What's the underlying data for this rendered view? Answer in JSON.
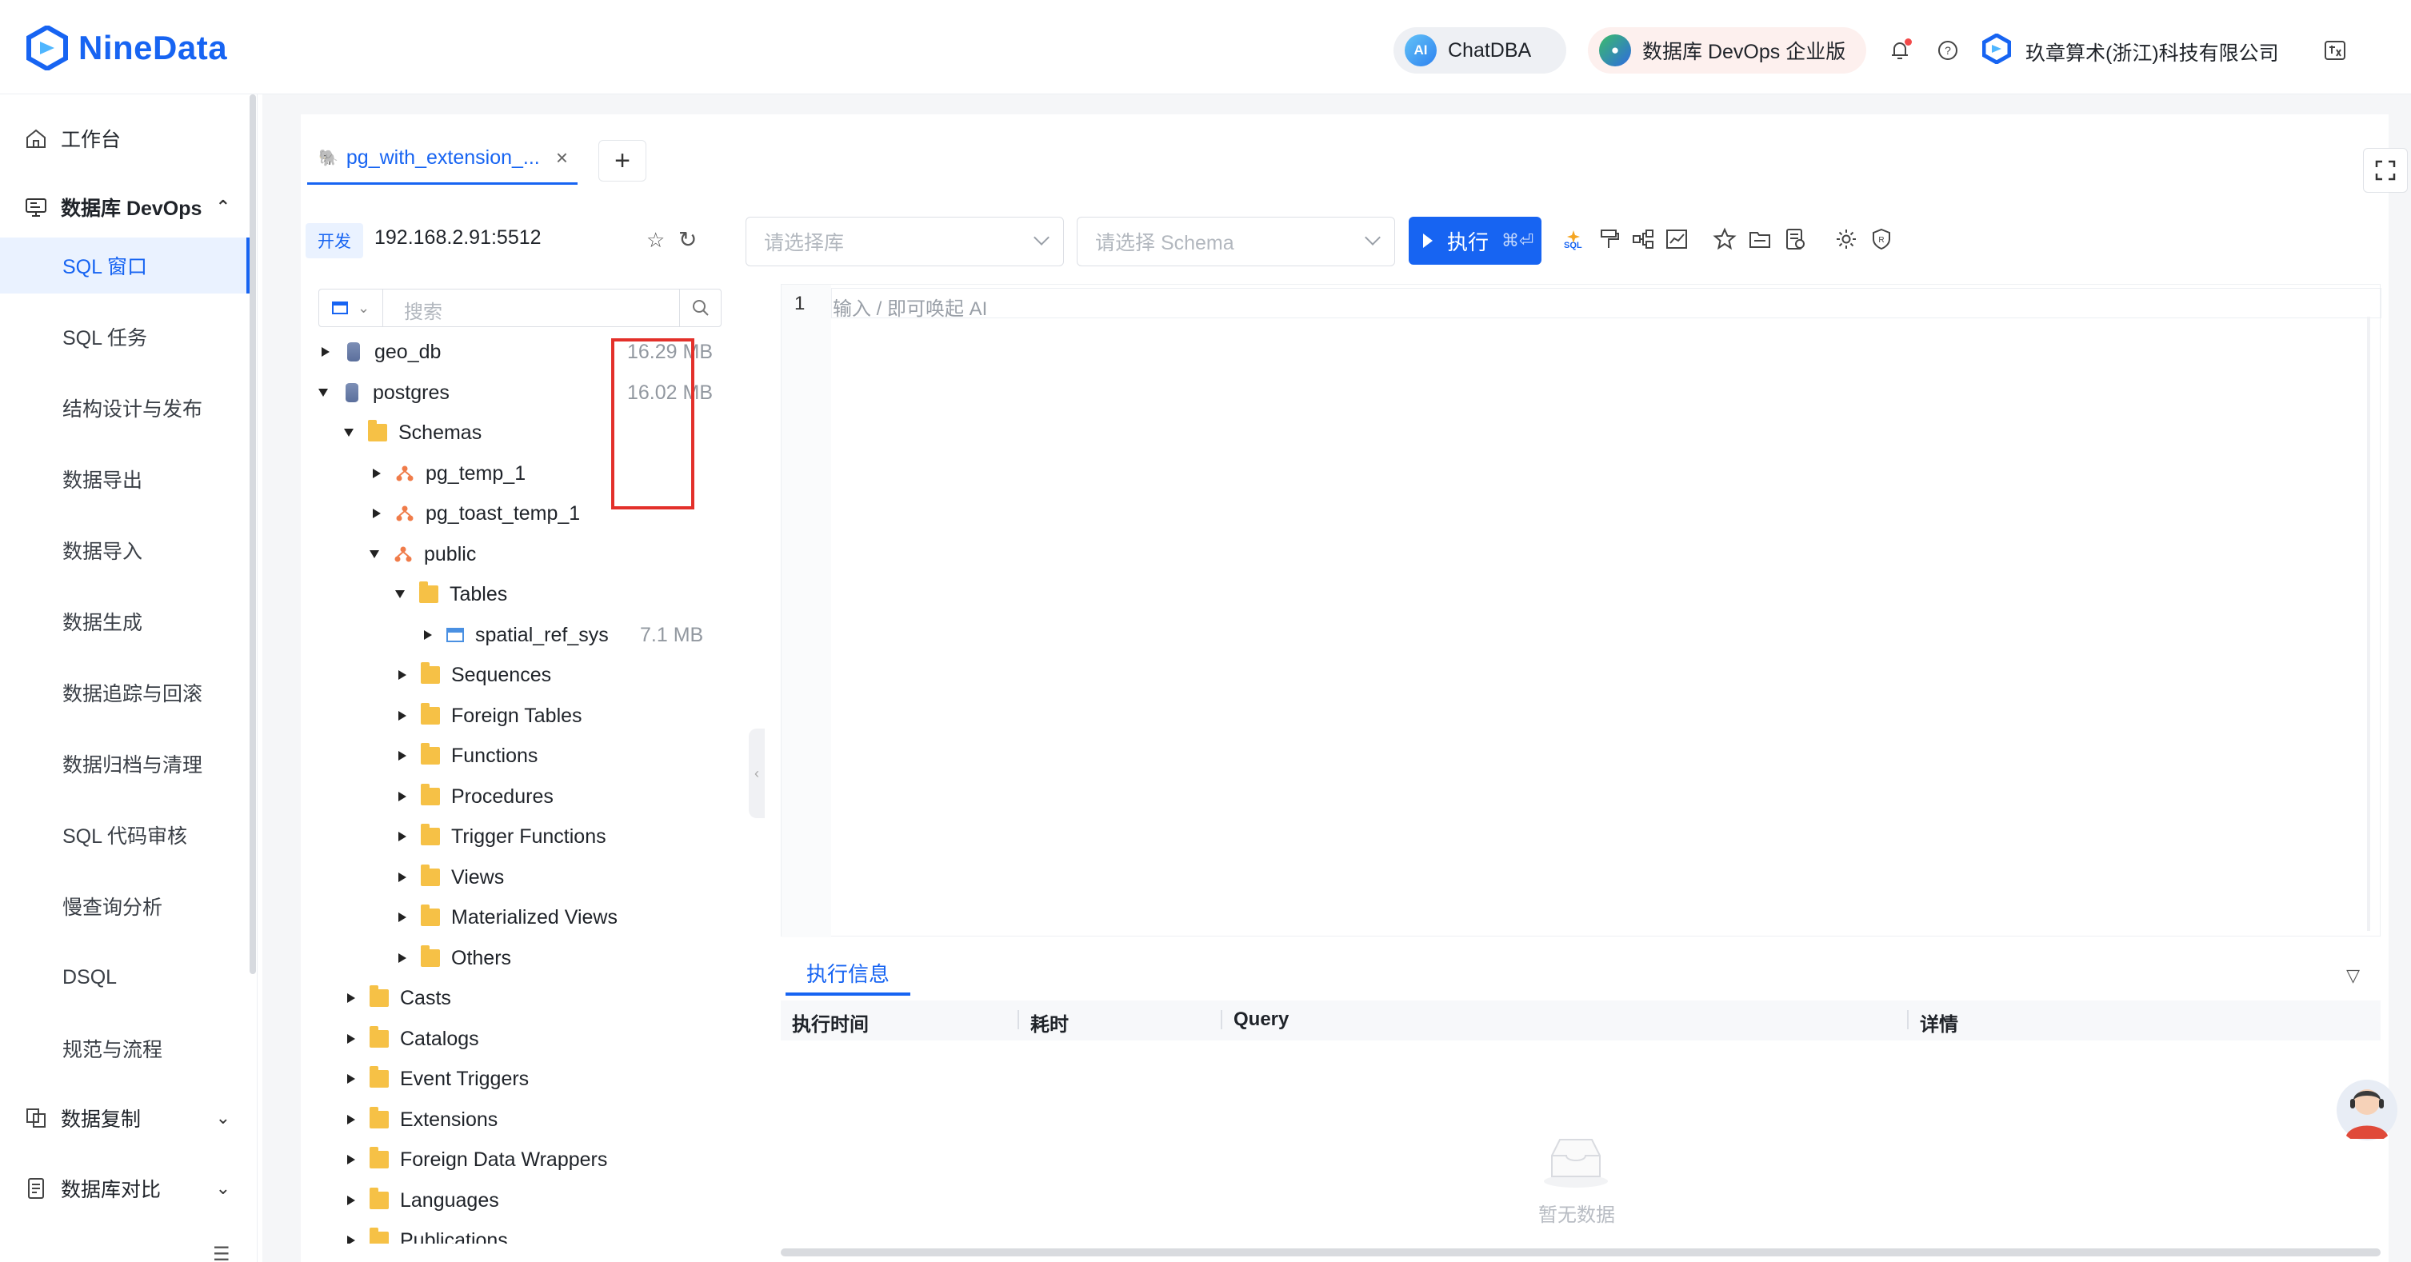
{
  "header": {
    "brand": "NineData",
    "chatdba": "ChatDBA",
    "chatdba_icon": "AI",
    "devops_edition": "数据库 DevOps 企业版",
    "org_name": "玖章算术(浙江)科技有限公司",
    "icons": [
      "bell-icon",
      "help-icon",
      "translate-icon"
    ],
    "accent": "#1764f2"
  },
  "sidebar": {
    "workbench": "工作台",
    "devops_group": "数据库 DevOps",
    "items": [
      {
        "label": "SQL 窗口",
        "active": true
      },
      {
        "label": "SQL 任务"
      },
      {
        "label": "结构设计与发布"
      },
      {
        "label": "数据导出"
      },
      {
        "label": "数据导入"
      },
      {
        "label": "数据生成"
      },
      {
        "label": "数据追踪与回滚"
      },
      {
        "label": "数据归档与清理"
      },
      {
        "label": "SQL 代码审核"
      },
      {
        "label": "慢查询分析"
      },
      {
        "label": "DSQL"
      },
      {
        "label": "规范与流程"
      }
    ],
    "replication_group": "数据复制",
    "compare_group": "数据库对比"
  },
  "tabs": {
    "active_tab": "pg_with_extension_...",
    "add_label": "+"
  },
  "connection": {
    "env": "开发",
    "host": "192.168.2.91:5512"
  },
  "toolbar": {
    "db_placeholder": "请选择库",
    "schema_placeholder": "请选择 Schema",
    "run_label": "执行",
    "run_hotkey": "⌘⏎",
    "icons": [
      "sql-format-icon",
      "paint-icon",
      "diagram-icon",
      "chart-icon",
      "star-icon",
      "folder-icon",
      "history-icon",
      "settings-icon",
      "shield-icon"
    ]
  },
  "tree": {
    "search_placeholder": "搜索",
    "nodes": [
      {
        "label": "geo_db",
        "size": "16.29 MB",
        "type": "db"
      },
      {
        "label": "postgres",
        "size": "16.02 MB",
        "type": "db"
      },
      {
        "label": "Schemas",
        "type": "folder"
      },
      {
        "label": "pg_temp_1",
        "type": "schema"
      },
      {
        "label": "pg_toast_temp_1",
        "type": "schema"
      },
      {
        "label": "public",
        "type": "schema"
      },
      {
        "label": "Tables",
        "type": "folder"
      },
      {
        "label": "spatial_ref_sys",
        "size": "7.1 MB",
        "type": "table"
      },
      {
        "label": "Sequences",
        "type": "folder"
      },
      {
        "label": "Foreign Tables",
        "type": "folder"
      },
      {
        "label": "Functions",
        "type": "folder"
      },
      {
        "label": "Procedures",
        "type": "folder"
      },
      {
        "label": "Trigger Functions",
        "type": "folder"
      },
      {
        "label": "Views",
        "type": "folder"
      },
      {
        "label": "Materialized Views",
        "type": "folder"
      },
      {
        "label": "Others",
        "type": "folder"
      },
      {
        "label": "Casts",
        "type": "folder"
      },
      {
        "label": "Catalogs",
        "type": "folder"
      },
      {
        "label": "Event Triggers",
        "type": "folder"
      },
      {
        "label": "Extensions",
        "type": "folder"
      },
      {
        "label": "Foreign Data Wrappers",
        "type": "folder"
      },
      {
        "label": "Languages",
        "type": "folder"
      },
      {
        "label": "Publications",
        "type": "folder"
      }
    ],
    "highlight_color": "#e3302a"
  },
  "editor": {
    "line_number": "1",
    "placeholder": "输入 / 即可唤起 AI"
  },
  "results": {
    "tab": "执行信息",
    "columns": [
      "执行时间",
      "耗时",
      "Query",
      "详情"
    ],
    "empty": "暂无数据"
  }
}
